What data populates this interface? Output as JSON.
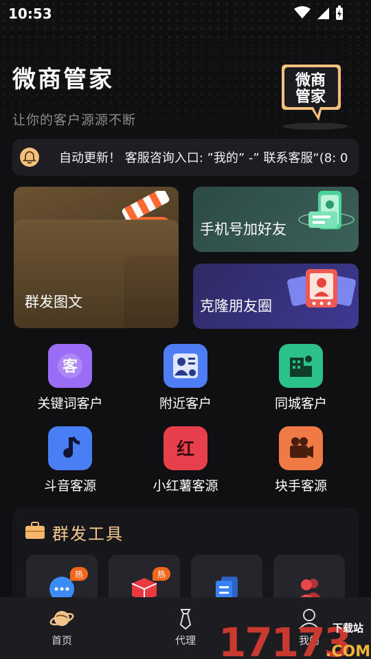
{
  "status": {
    "time": "10:53"
  },
  "header": {
    "title": "微商管家",
    "subtitle": "让你的客户源源不断",
    "logo_text_line1": "微商",
    "logo_text_line2": "管家"
  },
  "notice": {
    "text": "自动更新！  客服咨询入口: ”我的” -” 联系客服“(8: 0"
  },
  "cards": {
    "group_send": "群发图文",
    "phone_add": "手机号加好友",
    "clone_moments": "克隆朋友圈"
  },
  "features": [
    {
      "label": "关键词客户",
      "icon": "keyword-customer-icon",
      "color": "#9b6cf6"
    },
    {
      "label": "附近客户",
      "icon": "nearby-customer-icon",
      "color": "#4f7df6"
    },
    {
      "label": "同城客户",
      "icon": "same-city-icon",
      "color": "#2cc08a"
    },
    {
      "label": "斗音客源",
      "icon": "music-note-icon",
      "color": "#4a7ef5"
    },
    {
      "label": "小红薯客源",
      "icon": "red-book-icon",
      "color": "#e8404b"
    },
    {
      "label": "块手客源",
      "icon": "camera-icon",
      "color": "#f07a45"
    }
  ],
  "tools": {
    "title": "群发工具",
    "hot_badge": "热",
    "items": [
      "chat-bubble-icon",
      "red-box-icon",
      "copy-icon",
      "group-users-icon"
    ]
  },
  "tabbar": {
    "items": [
      {
        "label": "首页"
      },
      {
        "label": "代理"
      },
      {
        "label": "我的"
      }
    ]
  },
  "watermark": {
    "number": "17173",
    "site": "下载站",
    "domain": ".COM"
  },
  "colors": {
    "accent_gold": "#f4c98f",
    "hot": "#f2661e"
  }
}
